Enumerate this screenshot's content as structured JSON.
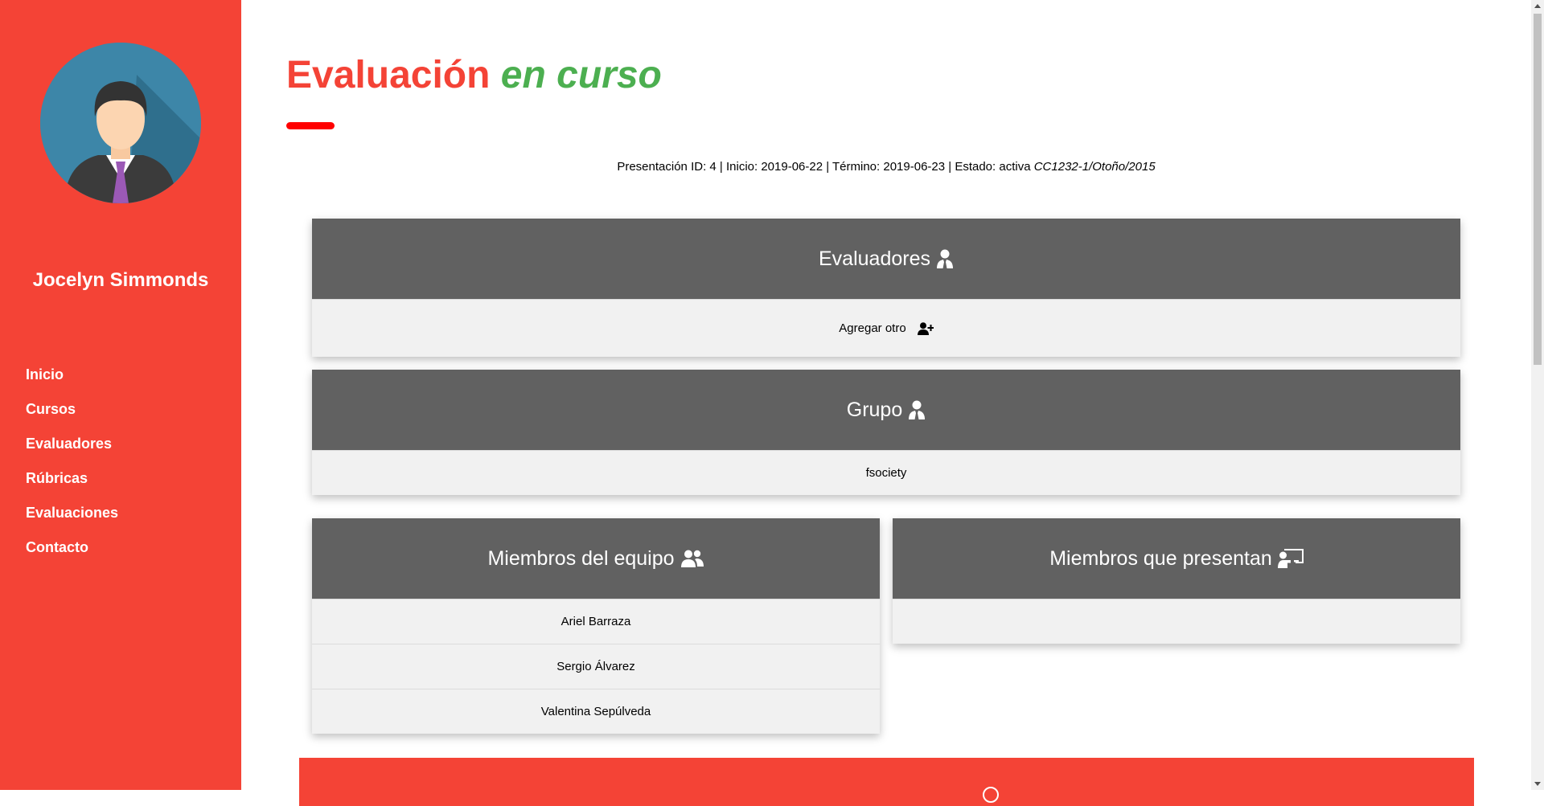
{
  "sidebar": {
    "user_name": "Jocelyn Simmonds",
    "nav": [
      {
        "label": "Inicio"
      },
      {
        "label": "Cursos"
      },
      {
        "label": "Evaluadores"
      },
      {
        "label": "Rúbricas"
      },
      {
        "label": "Evaluaciones"
      },
      {
        "label": "Contacto"
      }
    ]
  },
  "header": {
    "title_main": "Evaluación",
    "title_accent": "en curso"
  },
  "info": {
    "text": "Presentación ID: 4 | Inicio: 2019-06-22 | Término: 2019-06-23 | Estado: activa",
    "course": "CC1232-1/Otoño/2015"
  },
  "evaluadores": {
    "title": "Evaluadores",
    "add_label": "Agregar otro"
  },
  "grupo": {
    "title": "Grupo",
    "name": "fsociety"
  },
  "miembros": {
    "title": "Miembros del equipo",
    "items": [
      "Ariel Barraza",
      "Sergio Álvarez",
      "Valentina Sepúlveda"
    ]
  },
  "presentan": {
    "title": "Miembros que presentan"
  },
  "icons": {
    "evaluadores": "user-tie-icon",
    "grupo": "user-tie-icon",
    "miembros": "users-icon",
    "presentan": "chalkboard-teacher-icon",
    "add": "user-plus-icon"
  },
  "colors": {
    "sidebar": "#f44336",
    "title_main": "#f44336",
    "title_accent": "#4caf50",
    "card_header": "#616161",
    "card_body": "#f1f1f1"
  }
}
